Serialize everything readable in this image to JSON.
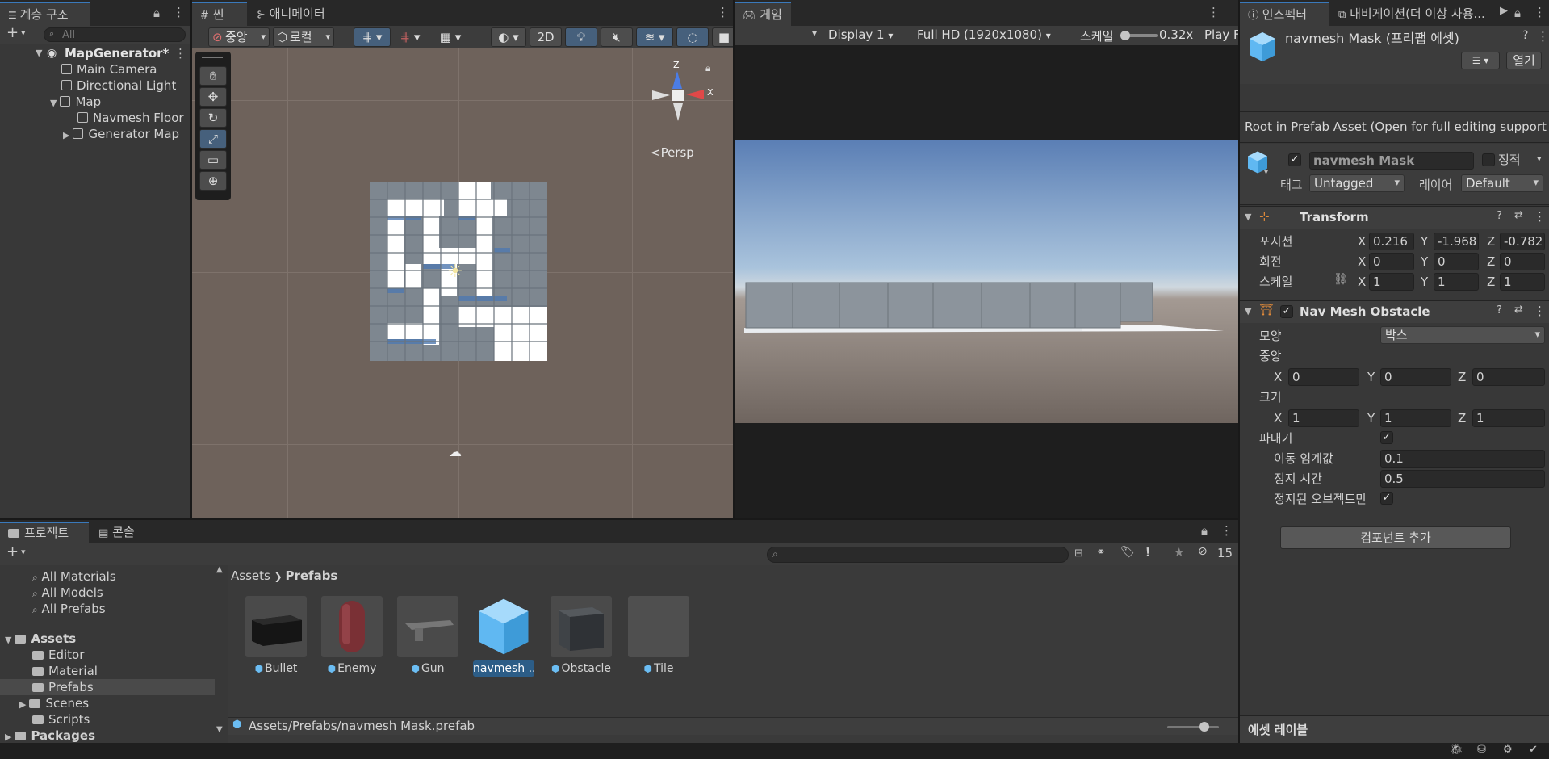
{
  "hierarchy": {
    "tab_label": "계층 구조",
    "search_placeholder": "All",
    "scene_name": "MapGenerator*",
    "items": [
      {
        "label": "Main Camera"
      },
      {
        "label": "Directional Light"
      },
      {
        "label": "Map"
      },
      {
        "label": "Navmesh Floor"
      },
      {
        "label": "Generator Map"
      }
    ]
  },
  "scene": {
    "tabs": [
      {
        "label": "씬"
      },
      {
        "label": "애니메이터"
      }
    ],
    "toolbar": {
      "pivot_label": "중앙",
      "space_label": "로컬",
      "mode_2d_label": "2D"
    },
    "persp_label": "<Persp",
    "gizmo": {
      "z": "Z",
      "x": "X"
    }
  },
  "game": {
    "tab_label": "게임",
    "display_label": "Display 1",
    "resolution_label": "Full HD (1920x1080)",
    "scale_label": "스케일",
    "scale_value": "0.32x",
    "play_label": "Play F"
  },
  "inspector": {
    "tabs": [
      {
        "label": "인스펙터"
      },
      {
        "label": "내비게이션(더 이상 사용..."
      }
    ],
    "title": "navmesh Mask (프리팹 에셋)",
    "open_label": "열기",
    "prefab_note": "Root in Prefab Asset (Open for full editing support",
    "object_name": "navmesh Mask",
    "static_label": "정적",
    "tag_label": "태그",
    "tag_value": "Untagged",
    "layer_label": "레이어",
    "layer_value": "Default",
    "transform": {
      "title": "Transform",
      "position_label": "포지션",
      "rotation_label": "회전",
      "scale_label": "스케일",
      "position": {
        "x": "0.216",
        "y": "-1.968",
        "z": "-0.782"
      },
      "rotation": {
        "x": "0",
        "y": "0",
        "z": "0"
      },
      "scale": {
        "x": "1",
        "y": "1",
        "z": "1"
      }
    },
    "obstacle": {
      "title": "Nav Mesh Obstacle",
      "shape_label": "모양",
      "shape_value": "박스",
      "center_label": "중앙",
      "center": {
        "x": "0",
        "y": "0",
        "z": "0"
      },
      "size_label": "크기",
      "size": {
        "x": "1",
        "y": "1",
        "z": "1"
      },
      "carve_label": "파내기",
      "move_threshold_label": "이동 임계값",
      "move_threshold_value": "0.1",
      "time_to_stationary_label": "정지 시간",
      "time_to_stationary_value": "0.5",
      "carve_only_stationary_label": "정지된 오브젝트만"
    },
    "add_component_label": "컴포넌트 추가",
    "asset_labels_title": "에셋 레이블"
  },
  "project": {
    "tabs": [
      {
        "label": "프로젝트"
      },
      {
        "label": "콘솔"
      }
    ],
    "hidden_count": "15",
    "tree": [
      {
        "label": "All Materials"
      },
      {
        "label": "All Models"
      },
      {
        "label": "All Prefabs"
      },
      {
        "label": "Assets"
      },
      {
        "label": "Editor"
      },
      {
        "label": "Material"
      },
      {
        "label": "Prefabs"
      },
      {
        "label": "Scenes"
      },
      {
        "label": "Scripts"
      },
      {
        "label": "Packages"
      }
    ],
    "breadcrumb": {
      "root": "Assets",
      "current": "Prefabs"
    },
    "assets": [
      {
        "label": "Bullet"
      },
      {
        "label": "Enemy"
      },
      {
        "label": "Gun"
      },
      {
        "label": "navmesh ..."
      },
      {
        "label": "Obstacle"
      },
      {
        "label": "Tile"
      }
    ],
    "path": "Assets/Prefabs/navmesh Mask.prefab"
  },
  "colors": {
    "accent": "#3a79bb",
    "selection": "#2c5d87",
    "prefab_blue": "#6bbdf3"
  }
}
